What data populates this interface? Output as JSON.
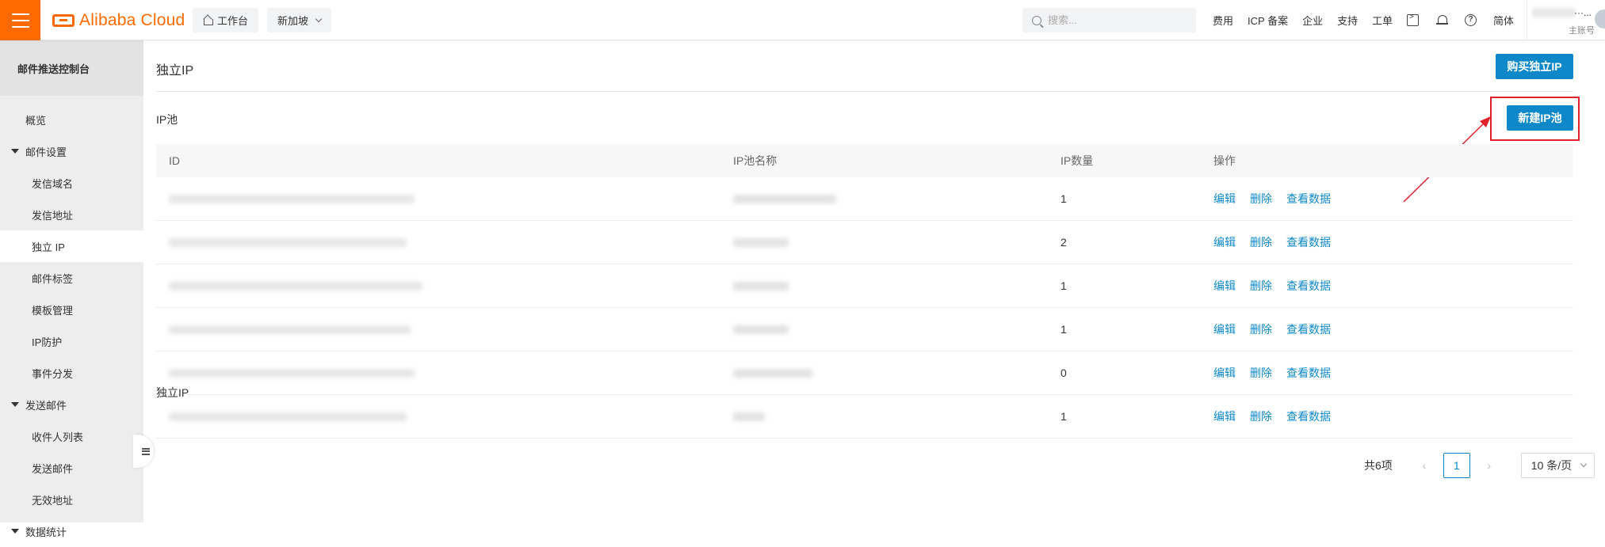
{
  "topbar": {
    "logo_text": "Alibaba Cloud",
    "workbench_label": "工作台",
    "region_label": "新加坡",
    "search_placeholder": "搜索...",
    "nav_links": [
      "费用",
      "ICP 备案",
      "企业",
      "支持",
      "工单"
    ],
    "lang_label": "简体",
    "account_name": "···...",
    "account_sub": "主账号"
  },
  "sidebar": {
    "title": "邮件推送控制台",
    "items": [
      {
        "label": "概览",
        "kind": "top"
      },
      {
        "label": "邮件设置",
        "kind": "group"
      },
      {
        "label": "发信域名",
        "kind": "child"
      },
      {
        "label": "发信地址",
        "kind": "child"
      },
      {
        "label": "独立 IP",
        "kind": "child",
        "active": true
      },
      {
        "label": "邮件标签",
        "kind": "child"
      },
      {
        "label": "模板管理",
        "kind": "child"
      },
      {
        "label": "IP防护",
        "kind": "child"
      },
      {
        "label": "事件分发",
        "kind": "child"
      },
      {
        "label": "发送邮件",
        "kind": "group"
      },
      {
        "label": "收件人列表",
        "kind": "child"
      },
      {
        "label": "发送邮件",
        "kind": "child"
      },
      {
        "label": "无效地址",
        "kind": "child"
      },
      {
        "label": "数据统计",
        "kind": "group"
      }
    ]
  },
  "main": {
    "page_title": "独立IP",
    "buy_button": "购买独立IP",
    "pool_section_title": "IP池",
    "new_pool_button": "新建IP池",
    "table": {
      "headers": [
        "ID",
        "IP池名称",
        "IP数量",
        "操作"
      ],
      "rows": [
        {
          "count": "1"
        },
        {
          "count": "2"
        },
        {
          "count": "1"
        },
        {
          "count": "1"
        },
        {
          "count": "0"
        },
        {
          "count": "1"
        }
      ],
      "ops": [
        "编辑",
        "删除",
        "查看数据"
      ]
    },
    "pagination": {
      "total": "共6项",
      "current": "1",
      "page_size": "10 条/页"
    },
    "ip_section_title": "独立IP"
  },
  "colors": {
    "brand_orange": "#ff6a00",
    "primary_blue": "#0e88c9",
    "highlight_red": "#e0202a"
  }
}
